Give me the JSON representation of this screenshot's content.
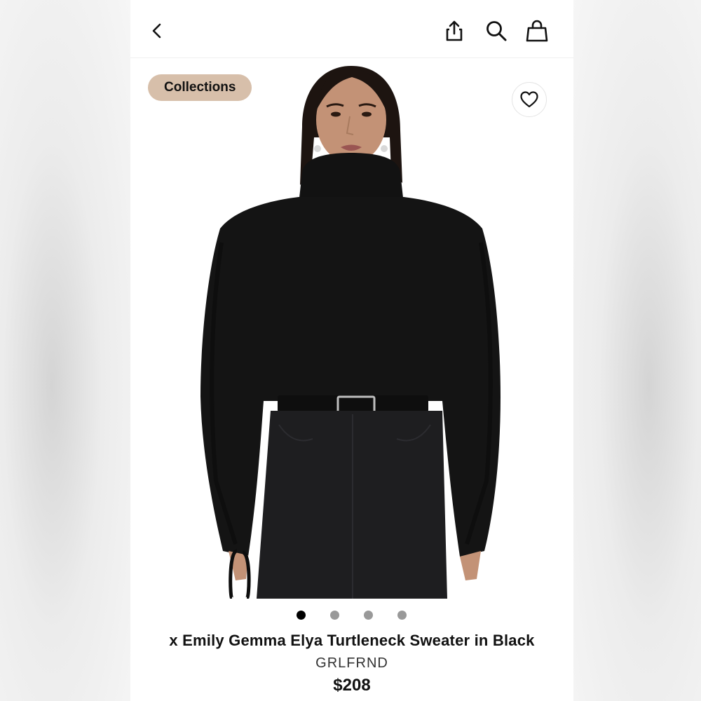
{
  "header": {
    "back_icon": "chevron-left-icon",
    "share_icon": "share-icon",
    "search_icon": "search-icon",
    "bag_icon": "shopping-bag-icon"
  },
  "gallery": {
    "badge_label": "Collections",
    "favorite_icon": "heart-icon",
    "image_description": "",
    "pagination": {
      "total": 4,
      "active_index": 0
    }
  },
  "product": {
    "title": "x Emily Gemma Elya Turtleneck Sweater in Black",
    "brand": "GRLFRND",
    "price": "$208"
  },
  "colors": {
    "badge_bg": "#d7bfaa",
    "dot_active": "#000000",
    "dot_inactive": "#999999",
    "sweater": "#141414",
    "denim": "#1e1e20"
  }
}
